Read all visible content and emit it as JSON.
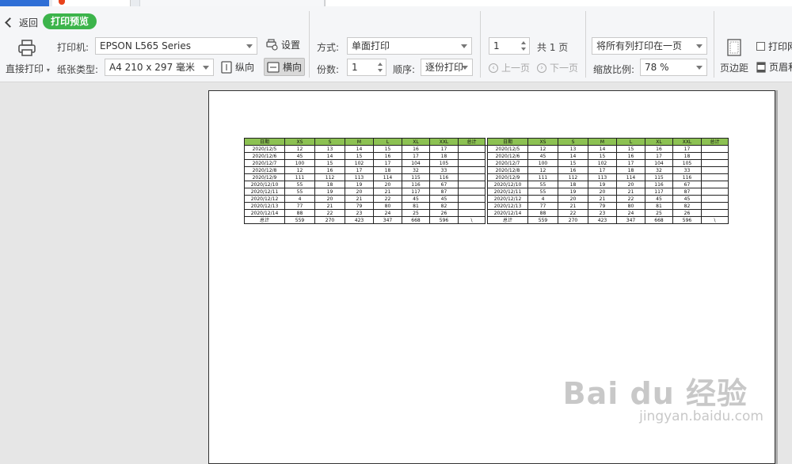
{
  "toolbar": {
    "back_label": "返回",
    "preview_badge": "打印预览",
    "direct_print_label": "直接打印",
    "printer_label": "打印机:",
    "printer_value": "EPSON L565 Series",
    "settings_label": "设置",
    "paper_label": "纸张类型:",
    "paper_value": "A4 210 x 297 毫米",
    "portrait_label": "纵向",
    "landscape_label": "横向",
    "mode_label": "方式:",
    "mode_value": "单面打印",
    "copies_label": "份数:",
    "copies_value": "1",
    "order_label": "顺序:",
    "order_value": "逐份打印",
    "page_value": "1",
    "page_total": "共 1 页",
    "prev_label": "上一页",
    "next_label": "下一页",
    "fit_value": "将所有列打印在一页",
    "zoom_label": "缩放比例:",
    "zoom_value": "78 %",
    "margin_label": "页边距",
    "gridlines_label": "打印网",
    "header_footer_label": "页眉和"
  },
  "sheet": {
    "headers": [
      "日期",
      "XS",
      "S",
      "M",
      "L",
      "XL",
      "XXL",
      "总计"
    ],
    "rows": [
      [
        "2020/12/5",
        "12",
        "13",
        "14",
        "15",
        "16",
        "17",
        ""
      ],
      [
        "2020/12/6",
        "45",
        "14",
        "15",
        "16",
        "17",
        "18",
        ""
      ],
      [
        "2020/12/7",
        "100",
        "15",
        "102",
        "17",
        "104",
        "105",
        ""
      ],
      [
        "2020/12/8",
        "12",
        "16",
        "17",
        "18",
        "32",
        "33",
        ""
      ],
      [
        "2020/12/9",
        "111",
        "112",
        "113",
        "114",
        "115",
        "116",
        ""
      ],
      [
        "2020/12/10",
        "55",
        "18",
        "19",
        "20",
        "116",
        "67",
        ""
      ],
      [
        "2020/12/11",
        "55",
        "19",
        "20",
        "21",
        "117",
        "87",
        ""
      ],
      [
        "2020/12/12",
        "4",
        "20",
        "21",
        "22",
        "45",
        "45",
        ""
      ],
      [
        "2020/12/13",
        "77",
        "21",
        "79",
        "80",
        "81",
        "82",
        ""
      ],
      [
        "2020/12/14",
        "88",
        "22",
        "23",
        "24",
        "25",
        "26",
        ""
      ]
    ],
    "total_row": [
      "总计",
      "559",
      "270",
      "423",
      "347",
      "668",
      "596",
      "\\"
    ]
  },
  "watermark": {
    "main": "Bai du 经验",
    "url": "jingyan.baidu.com"
  }
}
